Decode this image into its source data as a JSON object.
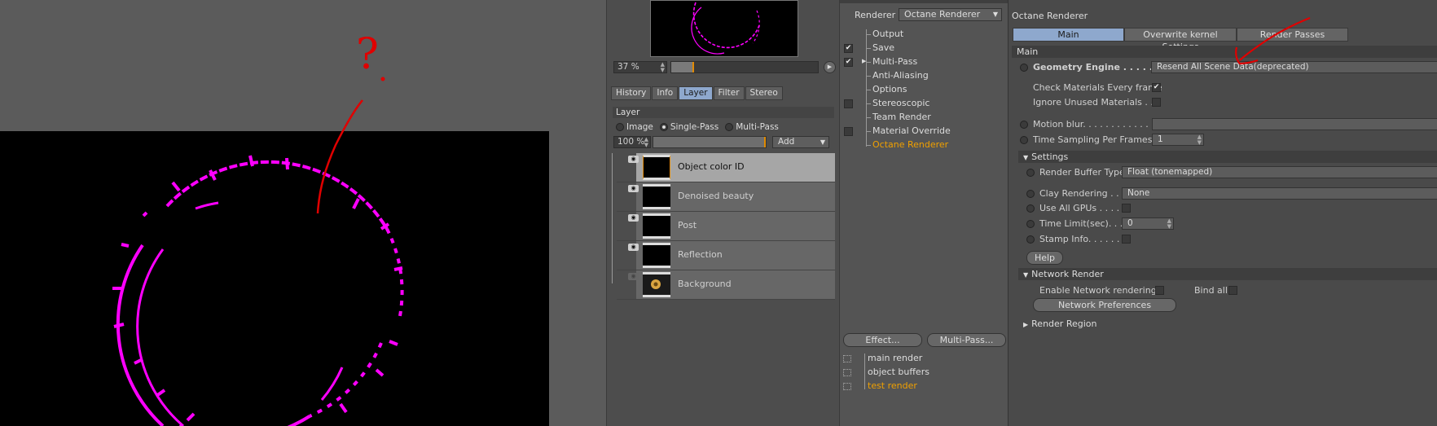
{
  "viewer": {
    "zoom": "37 %",
    "tabs": [
      "History",
      "Info",
      "Layer",
      "Filter",
      "Stereo"
    ],
    "active_tab": "Layer",
    "layer_header": "Layer",
    "modes": [
      "Image",
      "Single-Pass",
      "Multi-Pass"
    ],
    "active_mode": "Single-Pass",
    "opacity": "100 %",
    "add_label": "Add",
    "layers": [
      {
        "name": "Object color ID",
        "visible": true,
        "selected": true
      },
      {
        "name": "Denoised beauty",
        "visible": true,
        "selected": false
      },
      {
        "name": "Post",
        "visible": true,
        "selected": false
      },
      {
        "name": "Reflection",
        "visible": true,
        "selected": false
      },
      {
        "name": "Background",
        "visible": false,
        "selected": false
      }
    ]
  },
  "render_settings": {
    "renderer_label": "Renderer",
    "renderer_value": "Octane Renderer",
    "items": [
      {
        "label": "Output",
        "checkbox": false,
        "checked": false
      },
      {
        "label": "Save",
        "checkbox": true,
        "checked": true
      },
      {
        "label": "Multi-Pass",
        "checkbox": true,
        "checked": true
      },
      {
        "label": "Anti-Aliasing",
        "checkbox": false,
        "checked": false
      },
      {
        "label": "Options",
        "checkbox": false,
        "checked": false
      },
      {
        "label": "Stereoscopic",
        "checkbox": true,
        "checked": false
      },
      {
        "label": "Team Render",
        "checkbox": false,
        "checked": false
      },
      {
        "label": "Material Override",
        "checkbox": true,
        "checked": false
      },
      {
        "label": "Octane Renderer",
        "checkbox": false,
        "checked": false,
        "active": true
      }
    ],
    "effect_button": "Effect...",
    "multipass_button": "Multi-Pass...",
    "presets": [
      {
        "label": "main render",
        "active": false
      },
      {
        "label": "object buffers",
        "active": false
      },
      {
        "label": "test render",
        "active": true
      }
    ]
  },
  "octane": {
    "title": "Octane Renderer",
    "tabs": [
      "Main",
      "Overwrite kernel Settings",
      "Render Passes"
    ],
    "active_tab": "Main",
    "main_section": "Main",
    "geometry_engine_label": "Geometry Engine . . . . . . . .",
    "geometry_engine_value": "Resend All Scene Data(deprecated)",
    "check_materials_label": "Check Materials Every frame",
    "ignore_unused_label": "Ignore Unused Materials . .",
    "motion_blur_label": "Motion blur. . . . . . . . . . . . . .",
    "time_sampling_label": "Time Sampling Per Frames",
    "time_sampling_value": "1",
    "settings_section": "Settings",
    "render_buffer_label": "Render Buffer Type",
    "render_buffer_value": "Float (tonemapped)",
    "clay_label": "Clay Rendering . . .",
    "clay_value": "None",
    "all_gpus_label": "Use All GPUs . . . . . .",
    "time_limit_label": "Time Limit(sec). . . .",
    "time_limit_value": "0",
    "stamp_label": "Stamp Info. . . . . . . .",
    "help_button": "Help",
    "network_section": "Network Render",
    "enable_network_label": "Enable Network rendering",
    "bind_all_label": "Bind all",
    "network_prefs_button": "Network Preferences",
    "region_section": "Render Region"
  },
  "annotation": {
    "question_mark": "?"
  },
  "colors": {
    "magenta": "#ff00ff",
    "annotation_red": "#e00000",
    "active_orange": "#f0a000",
    "tab_blue": "#8ea8cd"
  }
}
